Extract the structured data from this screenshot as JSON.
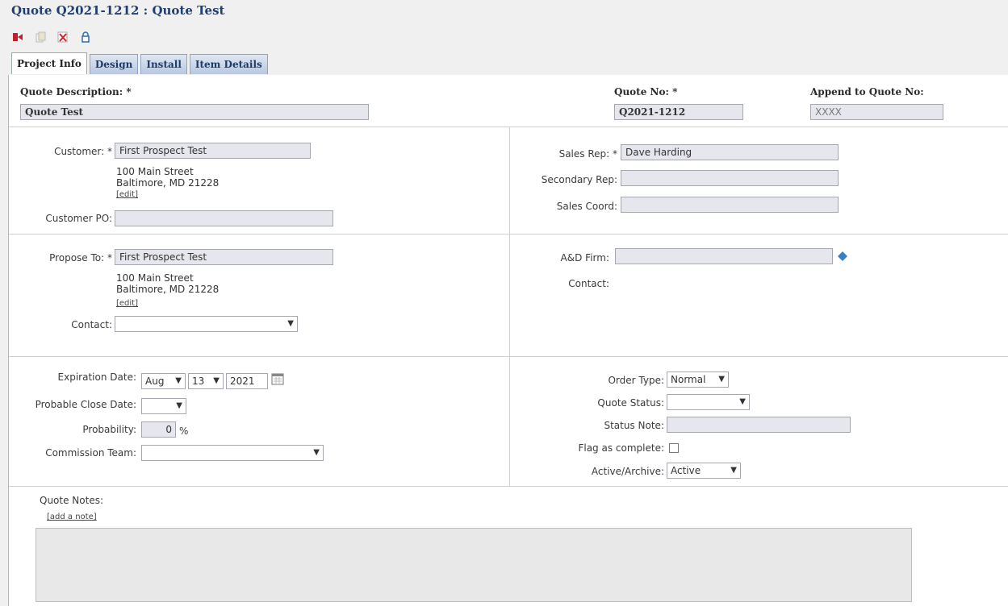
{
  "header": {
    "title": "Quote Q2021-1212 : Quote Test"
  },
  "toolbar": {
    "icons": [
      "exit-icon",
      "copy-icon",
      "delete-icon",
      "lock-icon"
    ]
  },
  "tabs": [
    {
      "label": "Project Info"
    },
    {
      "label": "Design"
    },
    {
      "label": "Install"
    },
    {
      "label": "Item Details"
    }
  ],
  "quote": {
    "description_label": "Quote Description: *",
    "description_value": "Quote Test",
    "number_label": "Quote No: *",
    "number_value": "Q2021-1212",
    "append_label": "Append to Quote No:",
    "append_placeholder": "XXXX"
  },
  "customer": {
    "customer_label": "Customer: *",
    "customer_value": "First Prospect Test",
    "address_line1": "100 Main Street",
    "address_line2": "Baltimore,  MD 21228",
    "edit_link": "[edit]",
    "po_label": "Customer PO:",
    "po_value": ""
  },
  "sales": {
    "rep_label": "Sales Rep: *",
    "rep_value": "Dave Harding",
    "secondary_label": "Secondary Rep:",
    "secondary_value": "",
    "coord_label": "Sales Coord:",
    "coord_value": ""
  },
  "propose": {
    "label": "Propose To: *",
    "value": "First Prospect Test",
    "address_line1": "100 Main Street",
    "address_line2": "Baltimore,  MD 21228",
    "edit_link": "[edit]",
    "contact_label": "Contact:",
    "contact_value": ""
  },
  "firm": {
    "label": "A&D Firm:",
    "value": "",
    "contact_label": "Contact:"
  },
  "dates": {
    "expiration_label": "Expiration Date:",
    "exp_month": "Aug",
    "exp_day": "13",
    "exp_year": "2021",
    "close_label": "Probable Close Date:",
    "close_value": "",
    "probability_label": "Probability:",
    "probability_value": "0",
    "probability_unit": "%",
    "commission_label": "Commission Team:",
    "commission_value": ""
  },
  "order": {
    "type_label": "Order Type:",
    "type_value": "Normal",
    "status_label": "Quote Status:",
    "status_value": "",
    "note_label": "Status Note:",
    "note_value": "",
    "flag_label": "Flag as complete:",
    "flag_checked": false,
    "active_label": "Active/Archive:",
    "active_value": "Active"
  },
  "notes": {
    "label": "Quote Notes:",
    "add_link": "[add a note]"
  },
  "colors": {
    "title": "#1f3f72",
    "tab_bg": "#c9d6ea",
    "field_bg": "#e6e6ef"
  }
}
